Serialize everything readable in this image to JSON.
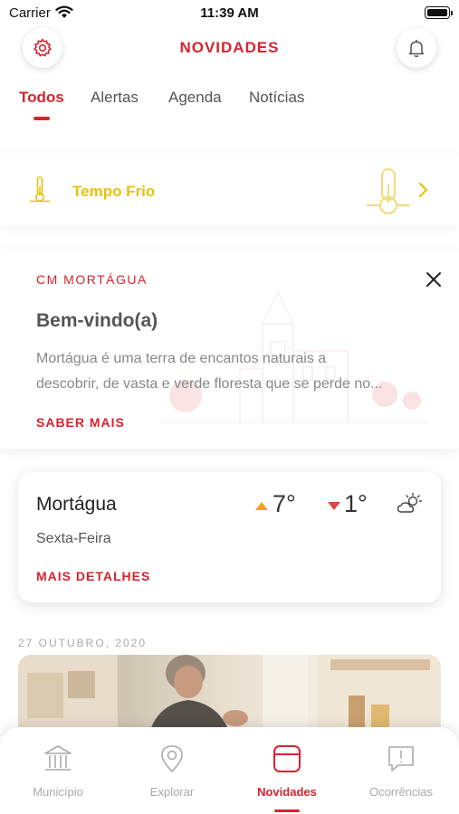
{
  "status_bar": {
    "carrier": "Carrier",
    "time": "11:39 AM"
  },
  "header": {
    "title": "NOVIDADES"
  },
  "tabs": [
    {
      "label": "Todos",
      "active": true
    },
    {
      "label": "Alertas"
    },
    {
      "label": "Agenda"
    },
    {
      "label": "Notícias"
    }
  ],
  "alert": {
    "text": "Tempo Frio",
    "color": "#e8c10f"
  },
  "welcome": {
    "org": "CM MORTÁGUA",
    "title": "Bem-vindo(a)",
    "line1": "Mortágua é uma terra de encantos naturais a",
    "line2": "descobrir, de vasta e verde floresta que se perde no...",
    "more": "SABER MAIS"
  },
  "weather": {
    "city": "Mortágua",
    "day": "Sexta-Feira",
    "max": "7°",
    "min": "1°",
    "more": "MAIS DETALHES"
  },
  "feed": {
    "date": "27 OUTUBRO, 2020"
  },
  "tabbar": [
    {
      "label": "Município",
      "icon": "building-icon"
    },
    {
      "label": "Explorar",
      "icon": "map-pin-icon"
    },
    {
      "label": "Novidades",
      "icon": "calendar-icon",
      "active": true
    },
    {
      "label": "Ocorrências",
      "icon": "alert-bubble-icon"
    }
  ],
  "colors": {
    "accent": "#d5242e",
    "alert": "#e8c10f"
  }
}
